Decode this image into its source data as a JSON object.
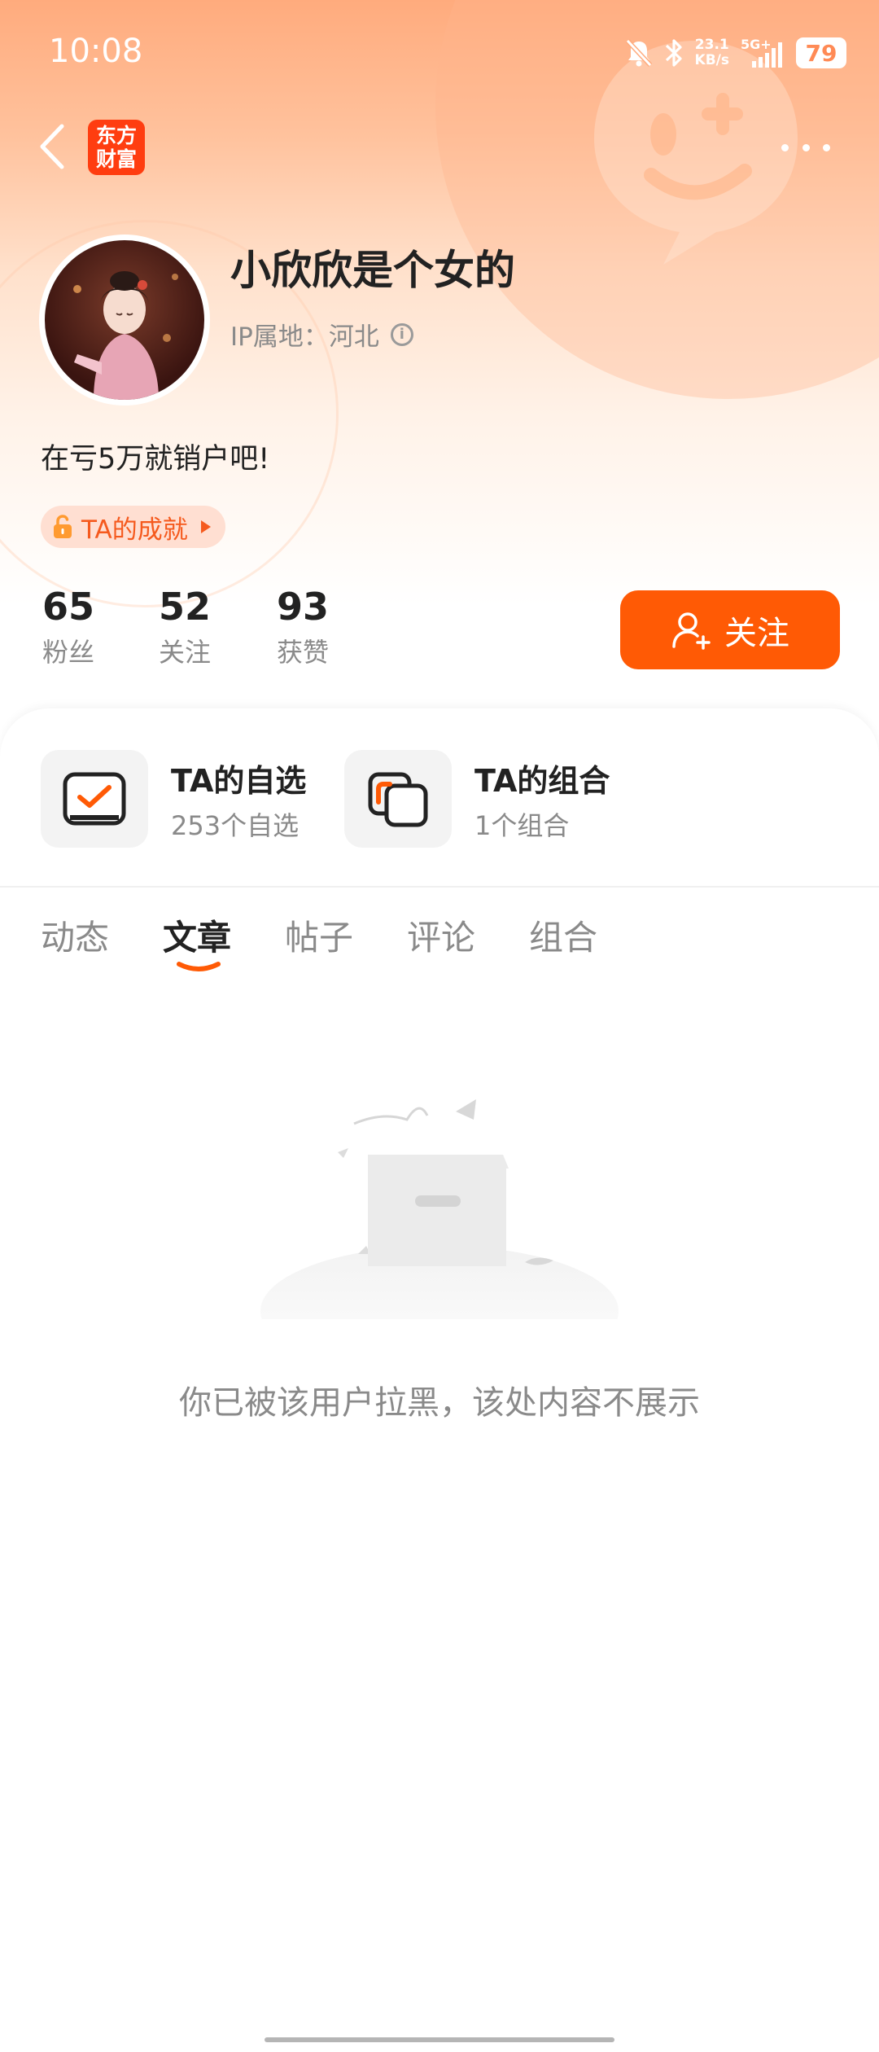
{
  "status_bar": {
    "time": "10:08",
    "network_speed": "23.1",
    "network_unit": "KB/s",
    "network_type": "5G+",
    "battery": "79"
  },
  "header": {
    "logo_line1": "东方",
    "logo_line2": "财富"
  },
  "profile": {
    "username": "小欣欣是个女的",
    "ip_location": "IP属地：河北",
    "bio": "在亏5万就销户吧!",
    "achievement_label": "TA的成就"
  },
  "stats": [
    {
      "value": "65",
      "label": "粉丝"
    },
    {
      "value": "52",
      "label": "关注"
    },
    {
      "value": "93",
      "label": "获赞"
    }
  ],
  "follow_button": "关注",
  "tools": [
    {
      "title": "TA的自选",
      "subtitle": "253个自选"
    },
    {
      "title": "TA的组合",
      "subtitle": "1个组合"
    }
  ],
  "tabs": [
    "动态",
    "文章",
    "帖子",
    "评论",
    "组合"
  ],
  "active_tab": "文章",
  "empty_message": "你已被该用户拉黑，该处内容不展示",
  "colors": {
    "accent": "#ff5a05",
    "logo_bg": "#ff3d10",
    "achievement_bg": "#ffdfd2"
  }
}
